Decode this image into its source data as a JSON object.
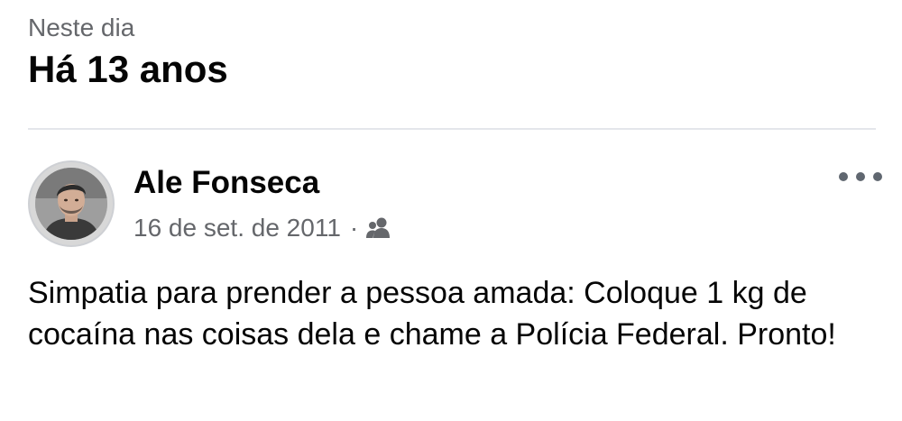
{
  "memory": {
    "subtitle": "Neste dia",
    "title": "Há 13 anos"
  },
  "post": {
    "author_name": "Ale Fonseca",
    "date": "16 de set. de 2011",
    "separator": "·",
    "audience_icon": "friends-icon",
    "more_icon": "more-options-icon",
    "text": "Simpatia para prender a pessoa amada: Coloque 1 kg de cocaína nas coisas dela e chame a Polícia Federal. Pronto!"
  },
  "colors": {
    "primary_text": "#050505",
    "secondary_text": "#65676b",
    "divider": "#e4e6eb",
    "icon": "#606770"
  }
}
